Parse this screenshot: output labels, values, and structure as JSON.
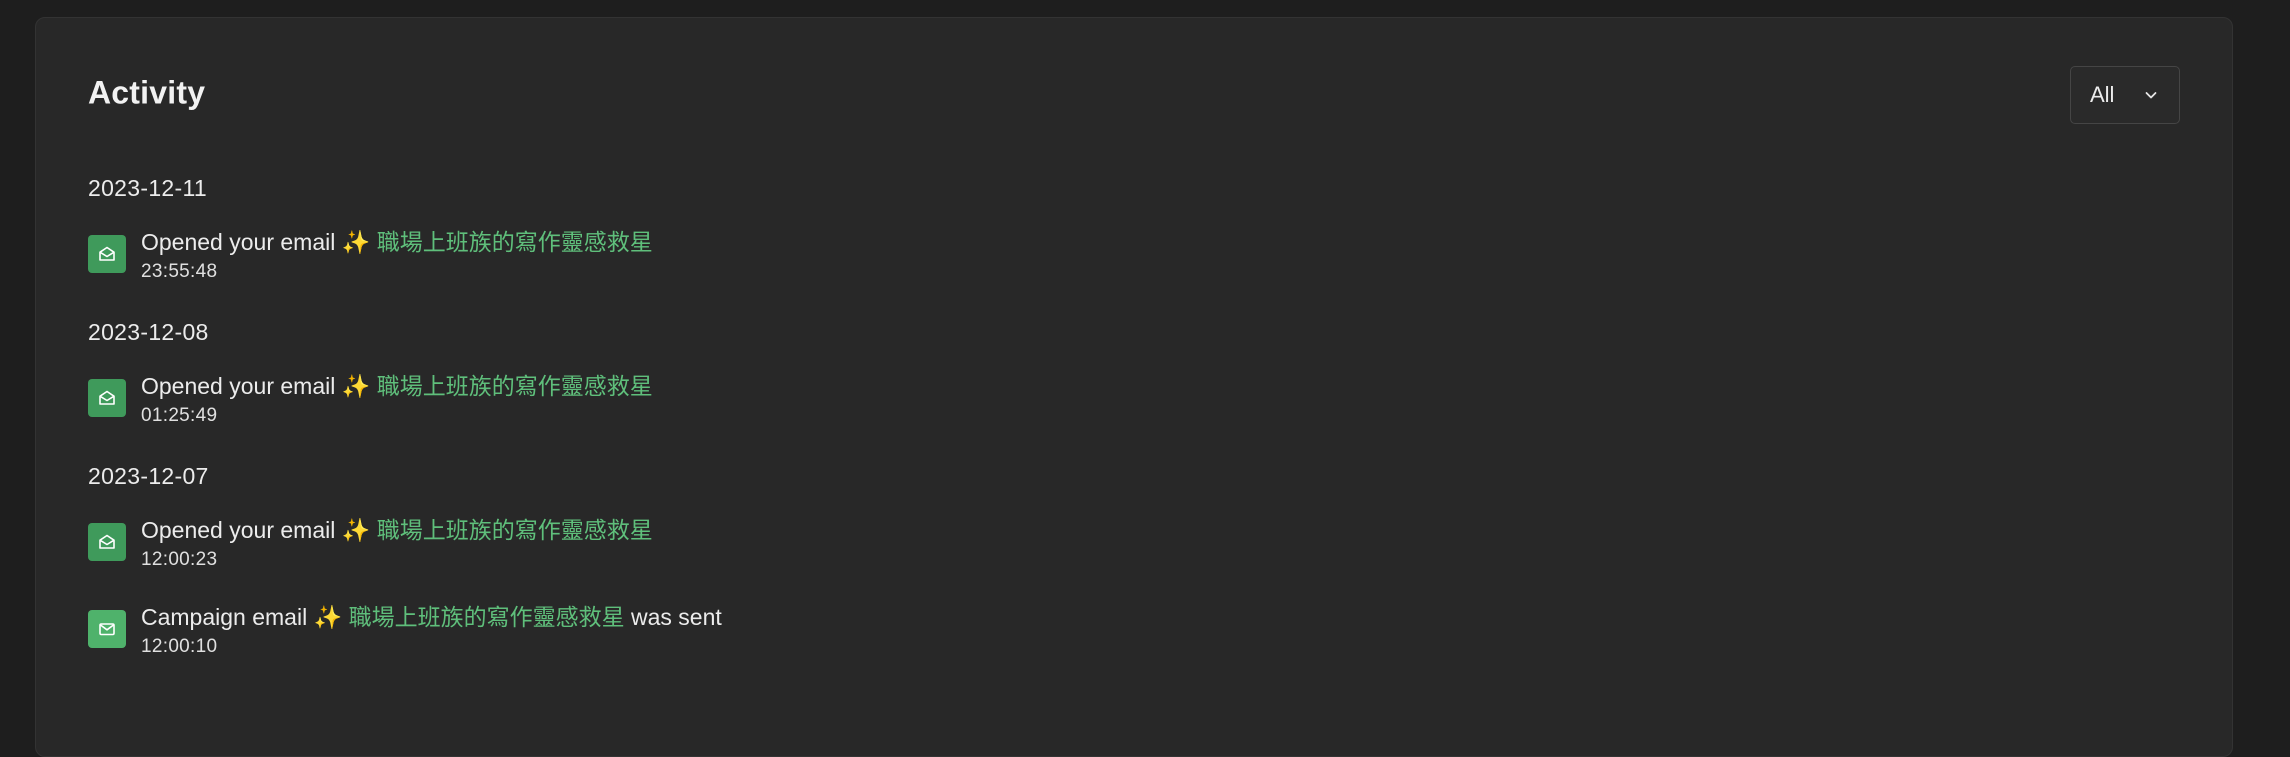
{
  "activity": {
    "title": "Activity",
    "filter": {
      "selected": "All"
    },
    "groups": [
      {
        "date": "2023-12-11",
        "items": [
          {
            "text": "Opened your email",
            "sparkle": "✨",
            "subject": "職場上班族的寫作靈感救星",
            "suffix": "",
            "time": "23:55:48",
            "icon": "envelope-open-icon"
          }
        ]
      },
      {
        "date": "2023-12-08",
        "items": [
          {
            "text": "Opened your email",
            "sparkle": "✨",
            "subject": "職場上班族的寫作靈感救星",
            "suffix": "",
            "time": "01:25:49",
            "icon": "envelope-open-icon"
          }
        ]
      },
      {
        "date": "2023-12-07",
        "items": [
          {
            "text": "Opened your email",
            "sparkle": "✨",
            "subject": "職場上班族的寫作靈感救星",
            "suffix": "",
            "time": "12:00:23",
            "icon": "envelope-open-icon"
          },
          {
            "text": "Campaign email",
            "sparkle": "✨",
            "subject": "職場上班族的寫作靈感救星",
            "suffix": "was sent",
            "time": "12:00:10",
            "icon": "envelope-icon"
          }
        ]
      }
    ]
  },
  "colors": {
    "background": "#1e1e1e",
    "card": "#282828",
    "accent_green": "#5fbf7b",
    "icon_green": "#3f9a5b"
  }
}
